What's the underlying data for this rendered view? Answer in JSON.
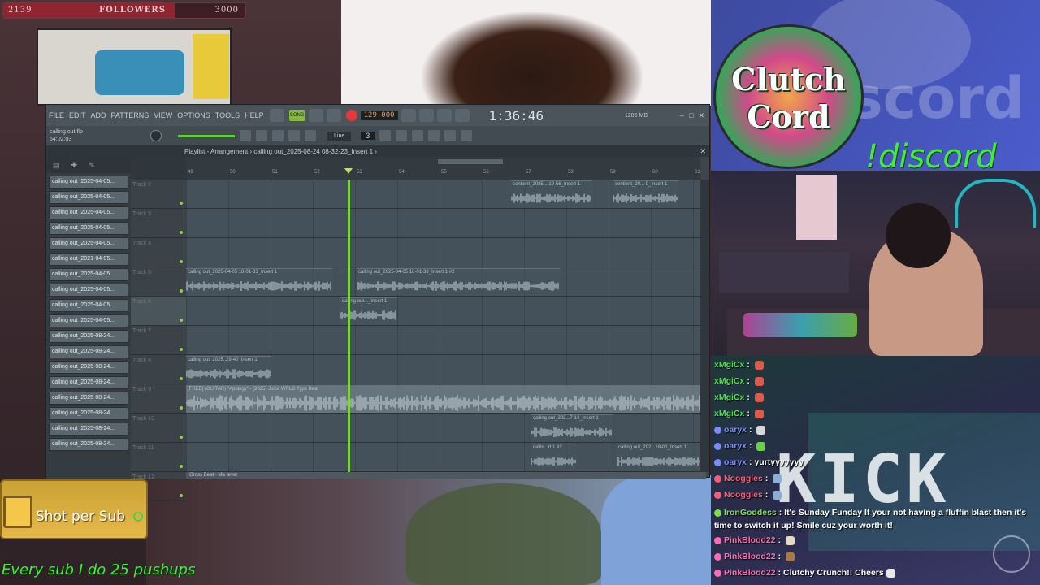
{
  "followers": {
    "current": "2139",
    "label": "FOLLOWERS",
    "goal": "3000",
    "progress": 0.713
  },
  "fl": {
    "menu": [
      "FILE",
      "EDIT",
      "ADD",
      "PATTERNS",
      "VIEW",
      "OPTIONS",
      "TOOLS",
      "HELP"
    ],
    "song_mode": "SONG",
    "tempo": "129.000",
    "time": "1:36:46",
    "memory": "1286 MB",
    "file_name": "calling out.flp",
    "file_time": "54:02:03",
    "track_hint": "Track 7",
    "snap": "Line",
    "step": "3",
    "playlist_title": "Playlist - Arrangement › calling out_2025-08-24 08-32-23_Insert 1 ›",
    "patterns": [
      "calling out_2025-04-05...",
      "calling out_2025-04-05...",
      "calling out_2025-04-05...",
      "calling out_2025-04-05...",
      "calling out_2025-04-05...",
      "calling out_2021-04-05...",
      "calling out_2025-04-05...",
      "calling out_2025-04-05...",
      "calling out_2025-04-05...",
      "calling out_2025-04-05...",
      "calling out_2025-08-24...",
      "calling out_2025-08-24...",
      "calling out_2025-08-24...",
      "calling out_2025-08-24...",
      "calling out_2025-08-24...",
      "calling out_2025-08-24...",
      "calling out_2025-08-24...",
      "calling out_2025-08-24..."
    ],
    "tracks": [
      "Track 2",
      "Track 3",
      "Track 4",
      "Track 5",
      "Track 6",
      "Track 7",
      "Track 8",
      "Track 9",
      "Track 10",
      "Track 11",
      "Track 12"
    ],
    "bars": [
      "49",
      "50",
      "51",
      "52",
      "53",
      "54",
      "55",
      "56",
      "57",
      "58",
      "59",
      "60",
      "61"
    ],
    "clips": [
      {
        "name": "sentient_2025... 19-56_Insert 1",
        "track": 0
      },
      {
        "name": "sentient_20... 9_Insert 1",
        "track": 0
      },
      {
        "name": "calling out_2025-04-05 18-01-33_Insert 1",
        "track": 3
      },
      {
        "name": "calling out_2025-04-05 18-01-33_Insert 1 #2",
        "track": 3
      },
      {
        "name": "calling out..._Insert 1",
        "track": 4
      },
      {
        "name": "calling out_2025..29-40_Insert 1",
        "track": 6
      },
      {
        "name": "[FREE] (GUITAR) \"Apology\" - (2025) Juice WRLD Type Beat",
        "track": 7
      },
      {
        "name": "calling out_202...7-14_Insert 1",
        "track": 8
      },
      {
        "name": "callin...rt 1 #2",
        "track": 9
      },
      {
        "name": "calling out_202...18-01_Insert 1",
        "track": 9
      }
    ],
    "status_bar": "Gross Beat - Mix level"
  },
  "overlay": {
    "logo_line1": "Clutch",
    "logo_line2": "Cord",
    "discord_command": "!discord",
    "kick_text": "KICK",
    "shot_per_sub": "Shot per Sub",
    "pushups": "Every sub I do 25 pushups"
  },
  "chat": [
    {
      "user": "xMgiCx",
      "color": "#4de34d",
      "text": ""
    },
    {
      "user": "xMgiCx",
      "color": "#4de34d",
      "text": ""
    },
    {
      "user": "xMgiCx",
      "color": "#4de34d",
      "text": ""
    },
    {
      "user": "xMgiCx",
      "color": "#4de34d",
      "text": ""
    },
    {
      "user": "oaryx",
      "color": "#7a8cff",
      "text": ""
    },
    {
      "user": "oaryx",
      "color": "#7a8cff",
      "text": ""
    },
    {
      "user": "oaryx",
      "color": "#7a8cff",
      "text": "yurtyyyyyyy"
    },
    {
      "user": "Nooggles",
      "color": "#ff5a7a",
      "text": ""
    },
    {
      "user": "Nooggles",
      "color": "#ff5a7a",
      "text": ""
    },
    {
      "user": "IronGoddess",
      "color": "#7ae04a",
      "text": "It's Sunday Funday If your not having a fluffin blast then it's time to switch it up! Smile cuz your worth it!"
    },
    {
      "user": "PinkBlood22",
      "color": "#ff6ab0",
      "text": ""
    },
    {
      "user": "PinkBlood22",
      "color": "#ff6ab0",
      "text": ""
    },
    {
      "user": "PinkBlood22",
      "color": "#ff6ab0",
      "text": "Clutchy Crunch!! Cheers"
    }
  ]
}
